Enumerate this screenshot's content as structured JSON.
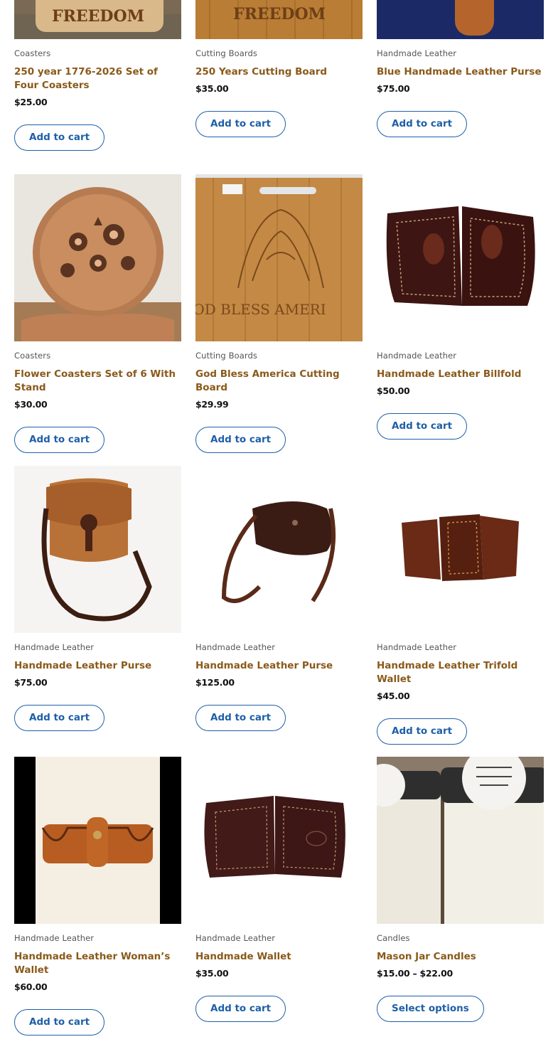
{
  "products": [
    {
      "category": "Coasters",
      "title": "250 year 1776-2026 Set of Four Coasters",
      "price": "$25.00",
      "button": "Add to cart",
      "image_text": "FREEDOM"
    },
    {
      "category": "Cutting Boards",
      "title": "250 Years Cutting Board",
      "price": "$35.00",
      "button": "Add to cart",
      "image_text": "FREEDOM"
    },
    {
      "category": "Handmade Leather",
      "title": "Blue Handmade Leather Purse",
      "price": "$75.00",
      "button": "Add to cart"
    },
    {
      "category": "Coasters",
      "title": "Flower Coasters Set of 6 With Stand",
      "price": "$30.00",
      "button": "Add to cart"
    },
    {
      "category": "Cutting Boards",
      "title": "God Bless America Cutting Board",
      "price": "$29.99",
      "button": "Add to cart",
      "image_text": "GOD BLESS AMERI"
    },
    {
      "category": "Handmade Leather",
      "title": "Handmade Leather Billfold",
      "price": "$50.00",
      "button": "Add to cart"
    },
    {
      "category": "Handmade Leather",
      "title": "Handmade Leather Purse",
      "price": "$75.00",
      "button": "Add to cart"
    },
    {
      "category": "Handmade Leather",
      "title": "Handmade Leather Purse",
      "price": "$125.00",
      "button": "Add to cart"
    },
    {
      "category": "Handmade Leather",
      "title": "Handmade Leather Trifold Wallet",
      "price": "$45.00",
      "button": "Add to cart"
    },
    {
      "category": "Handmade Leather",
      "title": "Handmade Leather Woman’s Wallet",
      "price": "$60.00",
      "button": "Add to cart"
    },
    {
      "category": "Handmade Leather",
      "title": "Handmade Wallet",
      "price": "$35.00",
      "button": "Add to cart"
    },
    {
      "category": "Candles",
      "title": "Mason Jar Candles",
      "price": "$15.00 – $22.00",
      "button": "Select options"
    }
  ],
  "colors": {
    "title": "#8a5a1a",
    "button": "#1e5fa8",
    "price": "#111111"
  }
}
